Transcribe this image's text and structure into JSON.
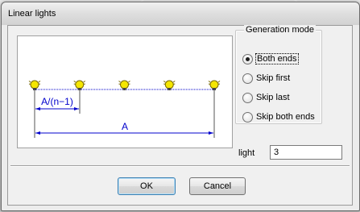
{
  "window": {
    "title": "Linear lights"
  },
  "diagram": {
    "lights_count": 5,
    "spacing_label": "A/(n−1)",
    "total_label": "A",
    "dimension_color": "#0000cc",
    "bulb_color": "#f5e600"
  },
  "generation_mode": {
    "legend": "Generation mode",
    "options": [
      {
        "label": "Both ends",
        "selected": true
      },
      {
        "label": "Skip first",
        "selected": false
      },
      {
        "label": "Skip last",
        "selected": false
      },
      {
        "label": "Skip both ends",
        "selected": false
      }
    ]
  },
  "light_field": {
    "label": "light",
    "value": "3"
  },
  "buttons": {
    "ok_label": "OK",
    "cancel_label": "Cancel"
  }
}
